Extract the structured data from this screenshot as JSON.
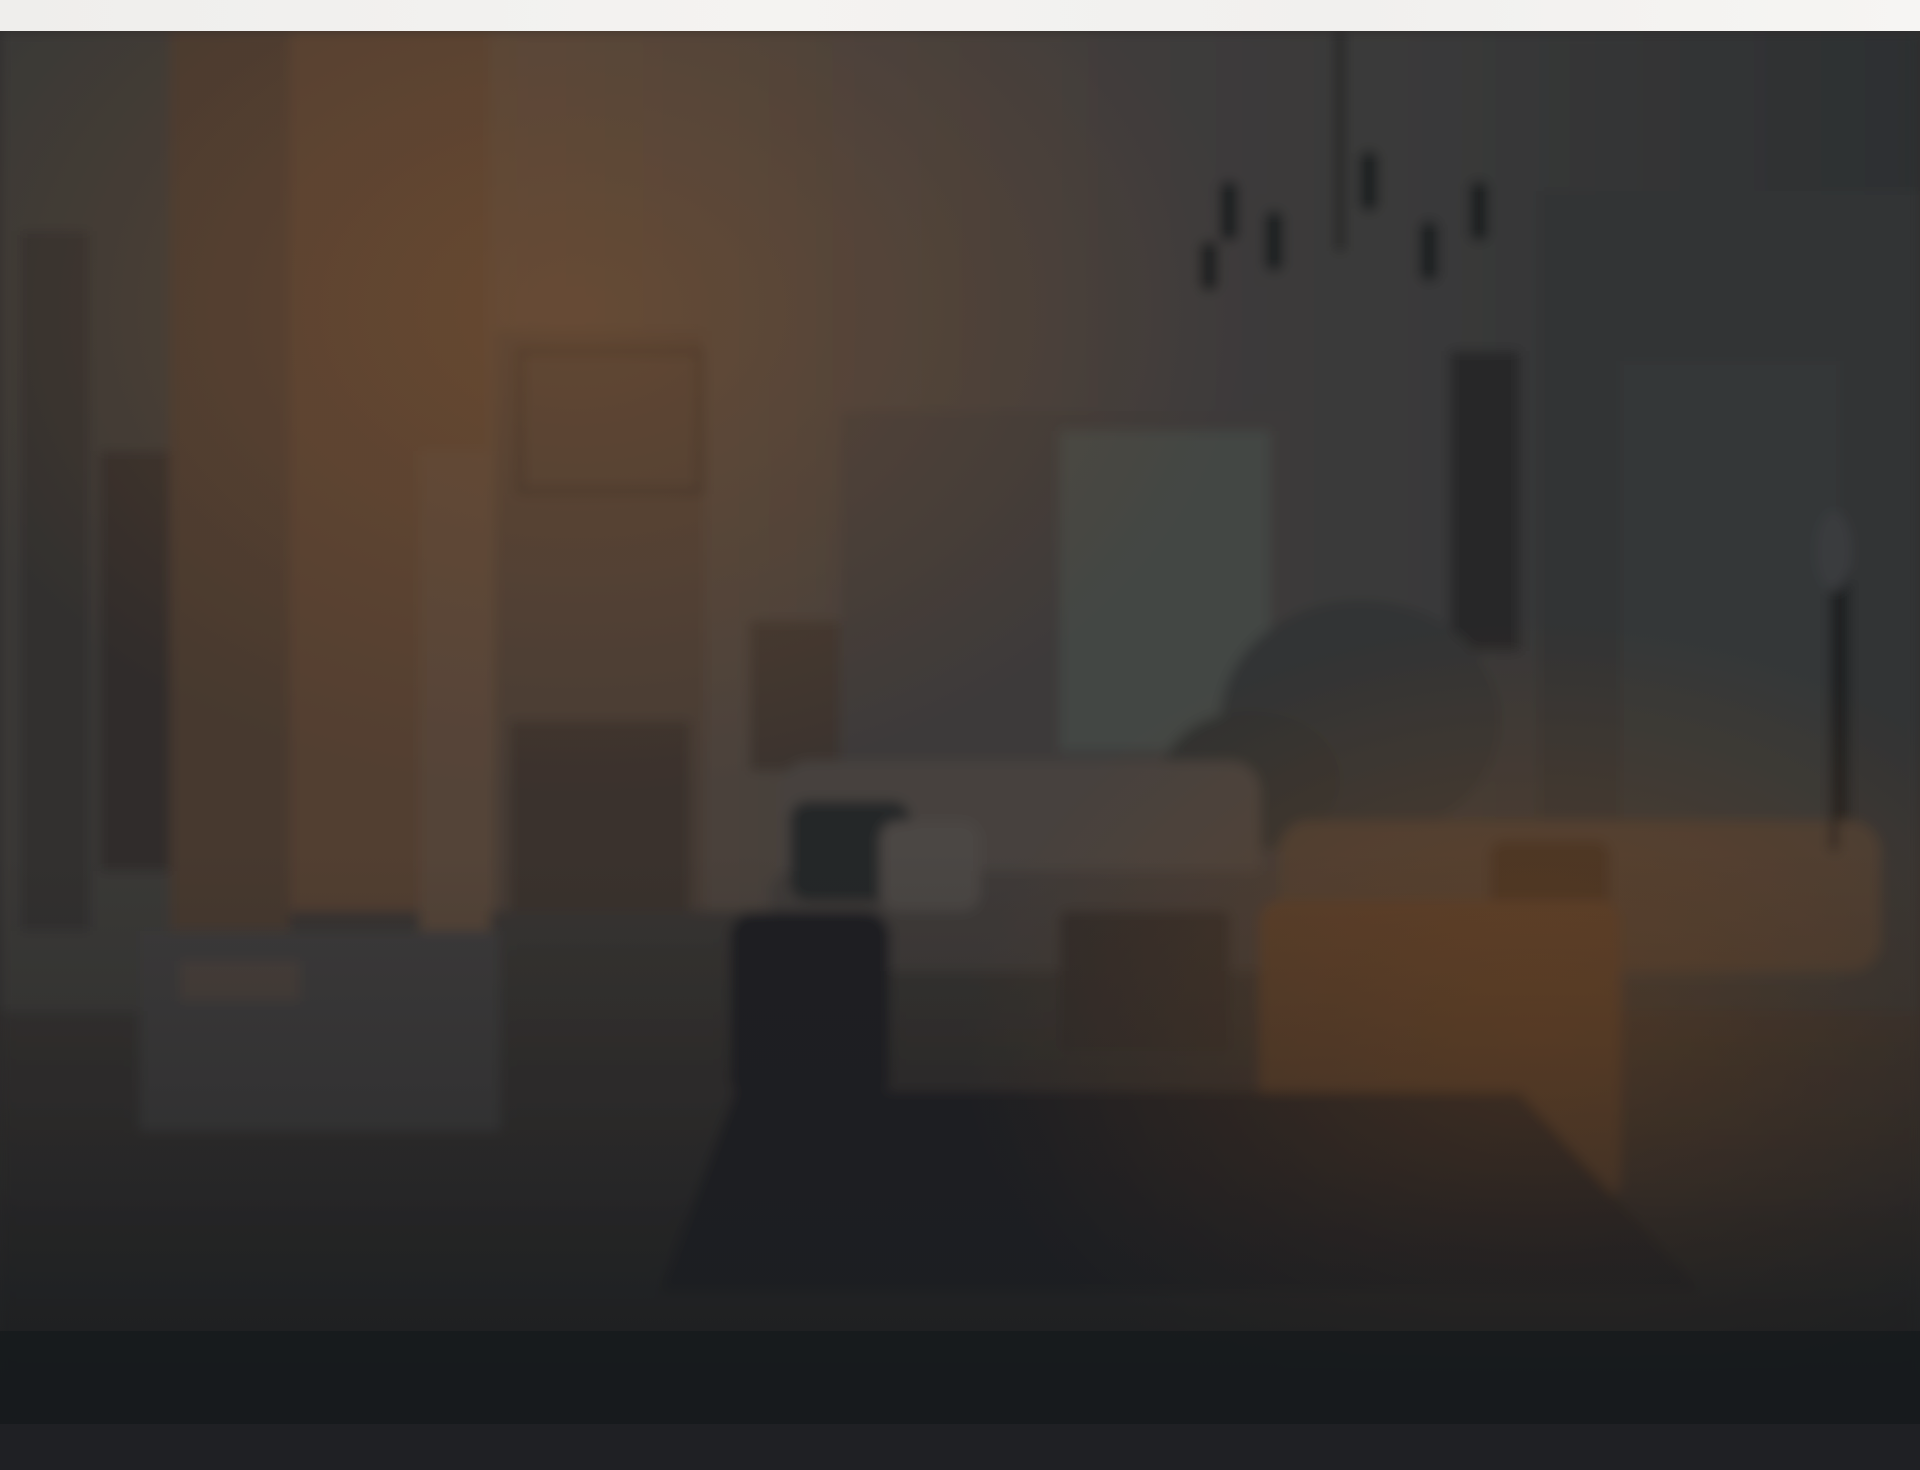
{
  "top_bar": {},
  "hero": {
    "image": "blurred-living-room-background",
    "overlay": "dark-gradient",
    "colors": {
      "warm": "#7a5538",
      "wall": "#4a4745",
      "floor": "#3a3029",
      "rug": "#1f2325",
      "footer": "#1d1e22"
    }
  },
  "bottom_bar": {}
}
